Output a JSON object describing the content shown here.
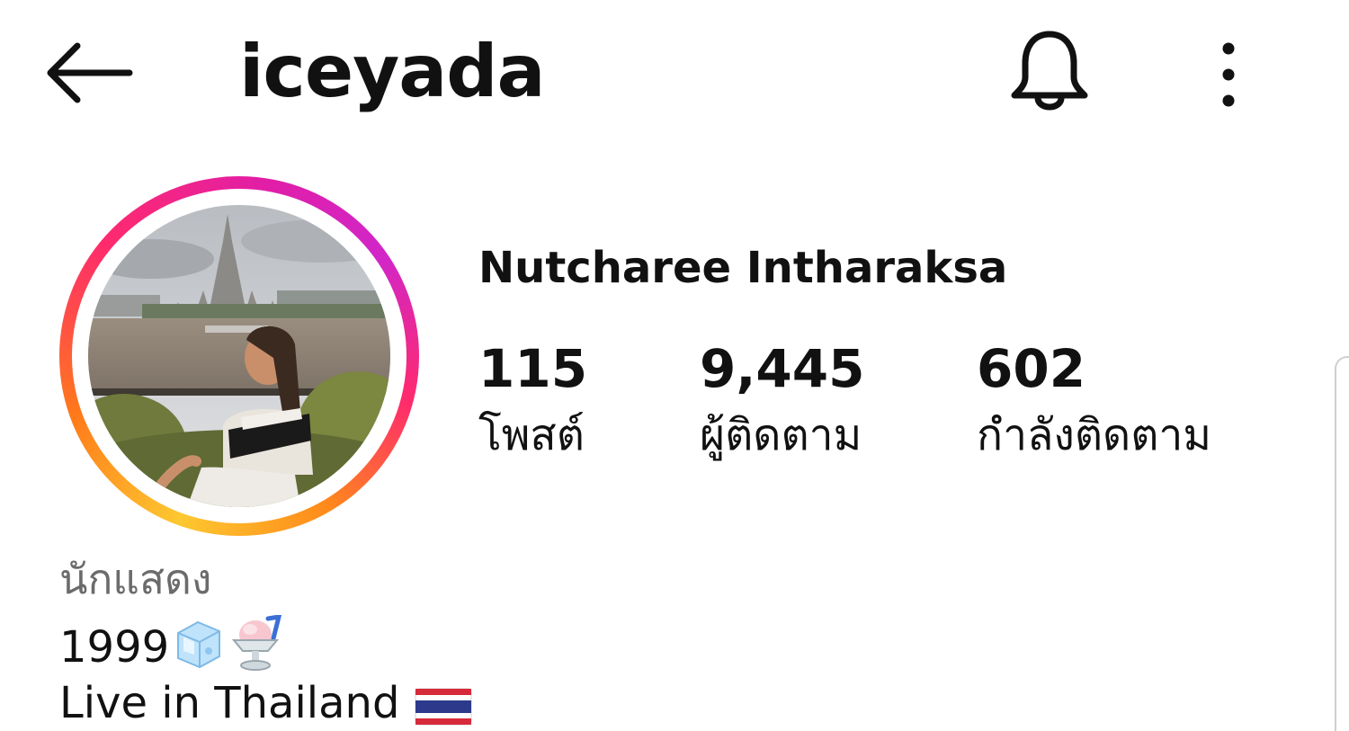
{
  "header": {
    "username": "iceyada",
    "back_icon": "arrow-left-icon",
    "notification_icon": "bell-icon",
    "menu_icon": "vertical-ellipsis-icon"
  },
  "profile": {
    "full_name": "Nutcharee Intharaksa",
    "story_ring_colors": [
      "#fdc830",
      "#ff7a1a",
      "#ff2a6d",
      "#e01ea8",
      "#d126c8"
    ]
  },
  "stats": [
    {
      "count": "115",
      "label": "โพสต์"
    },
    {
      "count": "9,445",
      "label": "ผู้ติดตาม"
    },
    {
      "count": "602",
      "label": "กำลังติดตาม"
    }
  ],
  "bio": {
    "category": "นักแสดง",
    "line1": "1999",
    "line1_emojis": [
      "ice-cube-emoji",
      "shaved-ice-emoji"
    ],
    "line2": "Live in Thailand",
    "line2_emoji": "thailand-flag-emoji"
  }
}
